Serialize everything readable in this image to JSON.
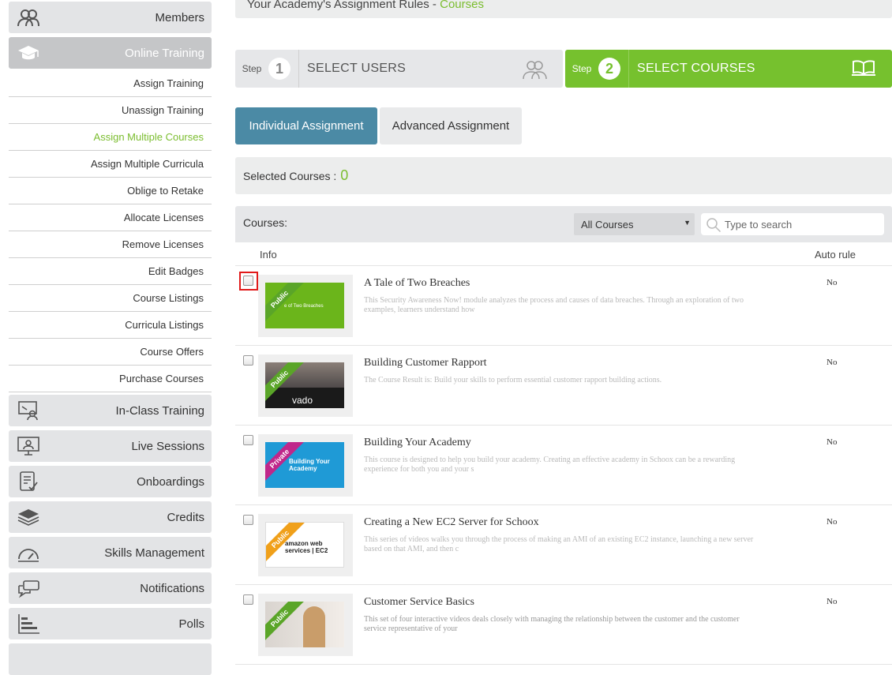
{
  "sidebar": {
    "top_items": [
      {
        "label": "Members",
        "icon": "members-icon"
      },
      {
        "label": "Online Training",
        "icon": "graduation-cap-icon"
      }
    ],
    "sub_items": [
      {
        "label": "Assign Training"
      },
      {
        "label": "Unassign Training"
      },
      {
        "label": "Assign Multiple Courses"
      },
      {
        "label": "Assign Multiple Curricula"
      },
      {
        "label": "Oblige to Retake"
      },
      {
        "label": "Allocate Licenses"
      },
      {
        "label": "Remove Licenses"
      },
      {
        "label": "Edit Badges"
      },
      {
        "label": "Course Listings"
      },
      {
        "label": "Curricula Listings"
      },
      {
        "label": "Course Offers"
      },
      {
        "label": "Purchase Courses"
      }
    ],
    "bottom_items": [
      {
        "label": "In-Class Training",
        "icon": "classroom-icon"
      },
      {
        "label": "Live Sessions",
        "icon": "monitor-user-icon"
      },
      {
        "label": "Onboardings",
        "icon": "checklist-icon"
      },
      {
        "label": "Credits",
        "icon": "layers-icon"
      },
      {
        "label": "Skills Management",
        "icon": "gauge-icon"
      },
      {
        "label": "Notifications",
        "icon": "chat-bubbles-icon"
      },
      {
        "label": "Polls",
        "icon": "bar-chart-icon"
      }
    ],
    "accent_color": "#7bbd2f"
  },
  "rules_bar": {
    "prefix": "Your Academy's Assignment Rules - ",
    "link": "Courses"
  },
  "steps": [
    {
      "step_word": "Step",
      "number": "1",
      "label": "SELECT USERS",
      "icon": "users-icon"
    },
    {
      "step_word": "Step",
      "number": "2",
      "label": "SELECT COURSES",
      "icon": "open-book-icon"
    }
  ],
  "tabs": [
    {
      "label": "Individual Assignment"
    },
    {
      "label": "Advanced Assignment"
    }
  ],
  "selected": {
    "label": "Selected Courses : ",
    "count": "0"
  },
  "courses": {
    "label": "Courses:",
    "filter_value": "All Courses",
    "search_placeholder": "Type to search",
    "col_info": "Info",
    "col_auto": "Auto rule",
    "rows": [
      {
        "title": "A Tale of Two Breaches",
        "desc": "This Security Awareness Now! module analyzes the process and causes of data breaches. Through an exploration of two examples, learners understand how",
        "auto": "No",
        "ribbon": "Public",
        "thumb_text": "e of Two Breaches"
      },
      {
        "title": "Building Customer Rapport",
        "desc": "The Course Result is: Build your skills to perform essential customer rapport building actions.",
        "auto": "No",
        "ribbon": "Public",
        "thumb_text": "vado"
      },
      {
        "title": "Building Your Academy",
        "desc": "This course is designed to help you build your academy. Creating an effective academy in Schoox can be a rewarding experience for both you and your s",
        "auto": "No",
        "ribbon": "Private",
        "thumb_text": "Building Your Academy"
      },
      {
        "title": "Creating a New EC2 Server for Schoox",
        "desc": "This series of videos walks you through the process of making an AMI of an existing EC2 instance, launching a new server based on that AMI, and then c",
        "auto": "No",
        "ribbon": "Public",
        "thumb_text": "amazon web services | EC2"
      },
      {
        "title": "Customer Service Basics",
        "desc": "This set of four interactive videos deals closely with managing the relationship between the customer and the customer service representative of your",
        "auto": "No",
        "ribbon": "Public",
        "thumb_text": ""
      }
    ]
  },
  "colors": {
    "green": "#76c12e",
    "blue_tab": "#4b8aa5",
    "private_ribbon": "#c0278a",
    "public_ribbon": "#5aa528"
  }
}
